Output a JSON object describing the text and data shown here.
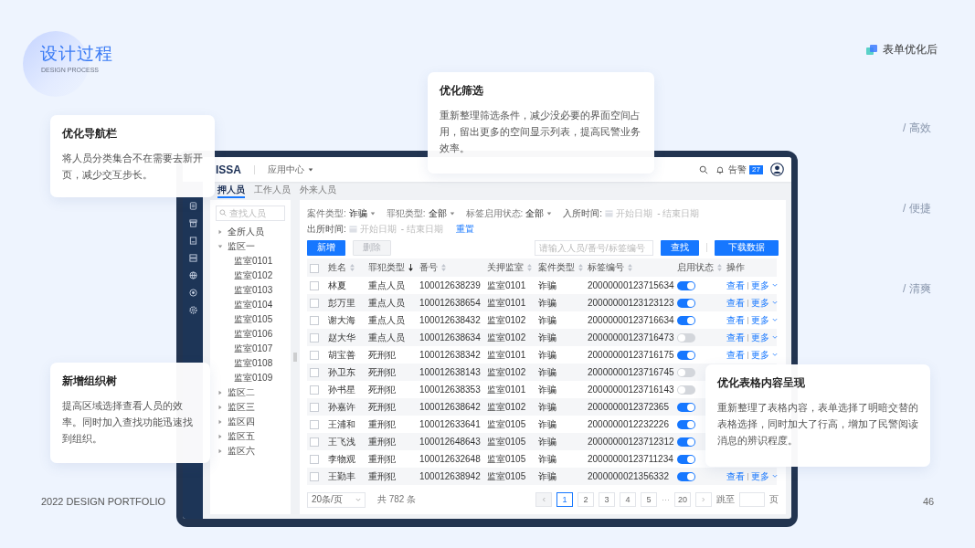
{
  "header": {
    "title": "设计过程",
    "subtitle": "DESIGN PROCESS"
  },
  "badge": {
    "label": "表单优化后"
  },
  "highlights": [
    "/ 高效",
    "/ 便捷",
    "/ 清爽"
  ],
  "footer": {
    "left": "2022 DESIGN PORTFOLIO",
    "page": "46"
  },
  "callouts": [
    {
      "title": "优化导航栏",
      "text": "将人员分类集合不在需要去新开页，减少交互步长。"
    },
    {
      "title": "优化筛选",
      "text": "重新整理筛选条件，减少没必要的界面空间占用，留出更多的空间显示列表，提高民警业务效率。"
    },
    {
      "title": "新增组织树",
      "text": "提高区域选择查看人员的效率。同时加入查找功能迅速找到组织。"
    },
    {
      "title": "优化表格内容呈现",
      "text": "重新整理了表格内容，表单选择了明暗交替的表格选择，同时加大了行高，增加了民警阅读消息的辨识程度。"
    }
  ],
  "app": {
    "logo": "ISSA",
    "menu": "应用中心",
    "alarm": {
      "label": "告警",
      "count": "27"
    },
    "tabs": [
      {
        "label": "押人员",
        "selected": true
      },
      {
        "label": "工作人员",
        "selected": false
      },
      {
        "label": "外来人员",
        "selected": false
      }
    ],
    "tree": {
      "placeholder": "查找人员",
      "nodes": [
        {
          "label": "全所人员",
          "expanded": false
        },
        {
          "label": "监区一",
          "expanded": true,
          "children": [
            {
              "label": "监室0101"
            },
            {
              "label": "监室0102"
            },
            {
              "label": "监室0103"
            },
            {
              "label": "监室0104"
            },
            {
              "label": "监室0105"
            },
            {
              "label": "监室0106"
            },
            {
              "label": "监室0107"
            },
            {
              "label": "监室0108"
            },
            {
              "label": "监室0109"
            }
          ]
        },
        {
          "label": "监区二",
          "expanded": false
        },
        {
          "label": "监区三",
          "expanded": false
        },
        {
          "label": "监区四",
          "expanded": false
        },
        {
          "label": "监区五",
          "expanded": false
        },
        {
          "label": "监区六",
          "expanded": false
        }
      ]
    },
    "filters": [
      {
        "kind": "select",
        "label": "案件类型:",
        "value": "诈骗"
      },
      {
        "kind": "select",
        "label": "罪犯类型:",
        "value": "全部"
      },
      {
        "kind": "select",
        "label": "标签启用状态:",
        "value": "全部"
      },
      {
        "kind": "date_range",
        "label": "入所时间:",
        "start": {
          "placeholder": "开始日期"
        },
        "separator": "-",
        "end": {
          "placeholder": "结束日期"
        }
      },
      {
        "kind": "date_range",
        "label": "出所时间:",
        "start": {
          "placeholder": "开始日期"
        },
        "separator": "-",
        "end": {
          "placeholder": "结束日期"
        }
      }
    ],
    "reset": "重置",
    "buttons": [
      {
        "label": "新增",
        "disabled": false
      },
      {
        "label": "删除",
        "disabled": true
      }
    ],
    "search": {
      "placeholder": "请输入人员/番号/标签编号",
      "button": "查找"
    },
    "download": "下载数据",
    "table": {
      "all_checked": false,
      "columns": [
        {
          "label": "姓名",
          "sorted": false
        },
        {
          "label": "罪犯类型",
          "sorted": true
        },
        {
          "label": "番号",
          "sorted": false
        },
        {
          "label": "关押监室",
          "sorted": false
        },
        {
          "label": "案件类型",
          "sorted": false
        },
        {
          "label": "标签编号",
          "sorted": false
        },
        {
          "label": "启用状态",
          "sorted": false
        },
        {
          "label": "操作"
        }
      ],
      "rows": [
        {
          "checked": false,
          "name": "林夏",
          "type": "重点人员",
          "number": "100012638239",
          "room": "监室0101",
          "case": "诈骗",
          "tag": "20000000123715634",
          "enabled": true,
          "actions": {
            "view": "查看",
            "more": "更多"
          }
        },
        {
          "checked": false,
          "name": "彭万里",
          "type": "重点人员",
          "number": "100012638654",
          "room": "监室0101",
          "case": "诈骗",
          "tag": "20000000123123123",
          "enabled": true,
          "actions": {
            "view": "查看",
            "more": "更多"
          }
        },
        {
          "checked": false,
          "name": "谢大海",
          "type": "重点人员",
          "number": "100012638432",
          "room": "监室0102",
          "case": "诈骗",
          "tag": "20000000123716634",
          "enabled": true,
          "actions": {
            "view": "查看",
            "more": "更多"
          }
        },
        {
          "checked": false,
          "name": "赵大华",
          "type": "重点人员",
          "number": "100012638634",
          "room": "监室0102",
          "case": "诈骗",
          "tag": "20000000123716473",
          "enabled": false,
          "actions": {
            "view": "查看",
            "more": "更多"
          }
        },
        {
          "checked": false,
          "name": "胡宝善",
          "type": "死刑犯",
          "number": "100012638342",
          "room": "监室0101",
          "case": "诈骗",
          "tag": "20000000123716175",
          "enabled": true,
          "actions": {
            "view": "查看",
            "more": "更多"
          }
        },
        {
          "checked": false,
          "name": "孙卫东",
          "type": "死刑犯",
          "number": "100012638143",
          "room": "监室0102",
          "case": "诈骗",
          "tag": "20000000123716745",
          "enabled": false
        },
        {
          "checked": false,
          "name": "孙书星",
          "type": "死刑犯",
          "number": "100012638353",
          "room": "监室0101",
          "case": "诈骗",
          "tag": "20000000123716143",
          "enabled": false
        },
        {
          "checked": false,
          "name": "孙嘉许",
          "type": "死刑犯",
          "number": "100012638642",
          "room": "监室0102",
          "case": "诈骗",
          "tag": "2000000012372365",
          "enabled": true
        },
        {
          "checked": false,
          "name": "王浦和",
          "type": "重刑犯",
          "number": "100012633641",
          "room": "监室0105",
          "case": "诈骗",
          "tag": "2000000012232226",
          "enabled": true
        },
        {
          "checked": false,
          "name": "王飞浅",
          "type": "重刑犯",
          "number": "100012648643",
          "room": "监室0105",
          "case": "诈骗",
          "tag": "20000000123712312",
          "enabled": true
        },
        {
          "checked": false,
          "name": "李物观",
          "type": "重刑犯",
          "number": "100012632648",
          "room": "监室0105",
          "case": "诈骗",
          "tag": "20000000123711234",
          "enabled": true
        },
        {
          "checked": false,
          "name": "王勤丰",
          "type": "重刑犯",
          "number": "100012638942",
          "room": "监室0105",
          "case": "诈骗",
          "tag": "2000000021356332",
          "enabled": true,
          "actions": {
            "view": "查看",
            "more": "更多"
          }
        }
      ]
    },
    "pagination": {
      "page_size": "20条/页",
      "total": "共 782 条",
      "prev_disabled": true,
      "next_disabled": false,
      "pages": [
        {
          "kind": "page",
          "label": "1",
          "selected": true
        },
        {
          "kind": "page",
          "label": "2",
          "selected": false
        },
        {
          "kind": "page",
          "label": "3",
          "selected": false
        },
        {
          "kind": "page",
          "label": "4",
          "selected": false
        },
        {
          "kind": "page",
          "label": "5",
          "selected": false
        },
        {
          "kind": "ellipsis",
          "label": "···"
        },
        {
          "kind": "page",
          "label": "20",
          "selected": false
        }
      ],
      "jump_label": "跳至",
      "jump_suffix": "页"
    }
  }
}
